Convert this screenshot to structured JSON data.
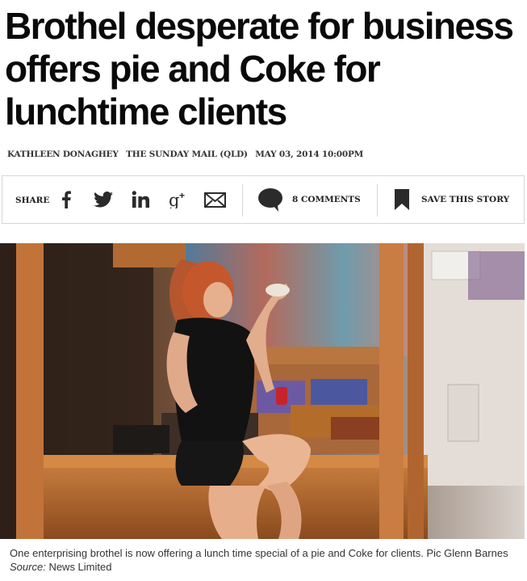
{
  "article": {
    "headline": "Brothel desperate for business offers pie and Coke for lunchtime clients",
    "byline": {
      "author": "KATHLEEN DONAGHEY",
      "publication": "THE SUNDAY MAIL (QLD)",
      "date": "MAY 03, 2014 10:00PM"
    }
  },
  "sharebar": {
    "share_label": "SHARE",
    "icons": [
      "facebook-icon",
      "twitter-icon",
      "linkedin-icon",
      "google-plus-icon",
      "email-icon"
    ],
    "comments_label": "8 COMMENTS",
    "save_label": "SAVE THIS STORY"
  },
  "photo": {
    "caption": "One enterprising brothel is now offering a lunch time special of a pie and Coke for clients. Pic Glenn Barnes",
    "source_label": "Source:",
    "source_value": "News Limited"
  },
  "colors": {
    "icon": "#2b2b2b",
    "border": "#d6d6d6",
    "text": "#0a0a0a"
  }
}
